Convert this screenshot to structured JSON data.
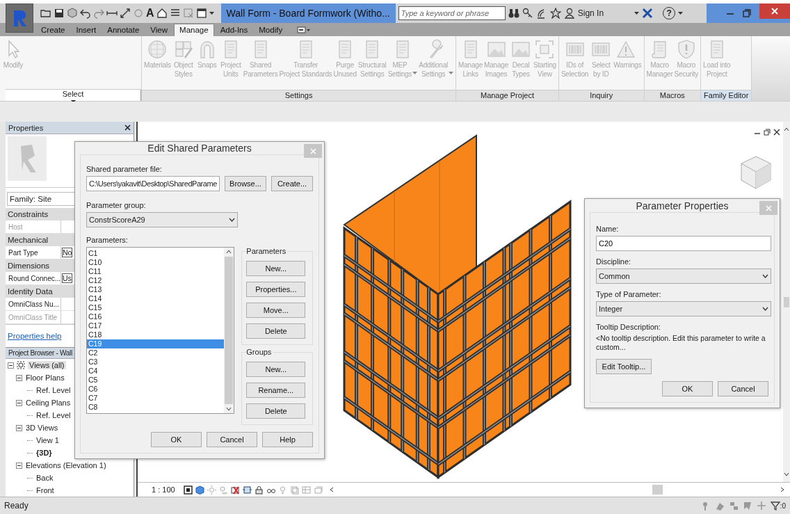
{
  "window": {
    "title": "Wall Form - Board Formwork (Witho...",
    "text_tool_glyph": "A",
    "search": {
      "placeholder": "Type a keyword or phrase"
    },
    "sign_in": "Sign In",
    "help_glyph": "?"
  },
  "tabs": [
    {
      "label": "Create",
      "selected": false
    },
    {
      "label": "Insert",
      "selected": false
    },
    {
      "label": "Annotate",
      "selected": false
    },
    {
      "label": "View",
      "selected": false
    },
    {
      "label": "Manage",
      "selected": true
    },
    {
      "label": "Add-Ins",
      "selected": false
    },
    {
      "label": "Modify",
      "selected": false
    }
  ],
  "ribbon": {
    "panels": [
      {
        "label": "Select",
        "menu": true,
        "highlighted": false,
        "buttons": [
          {
            "label": "Modify",
            "disabled": true,
            "menu": false
          }
        ]
      },
      {
        "label": "Settings",
        "menu": false,
        "highlighted": false,
        "buttons": [
          {
            "label": "Materials",
            "disabled": true,
            "menu": false
          },
          {
            "label": "Object\nStyles",
            "disabled": true,
            "menu": false
          },
          {
            "label": "Snaps",
            "disabled": true,
            "menu": false
          },
          {
            "label": "Project\nUnits",
            "disabled": true,
            "menu": false
          },
          {
            "label": "Shared\nParameters",
            "disabled": true,
            "menu": false
          },
          {
            "label": "Transfer\nProject Standards",
            "disabled": true,
            "menu": false
          },
          {
            "label": "Purge\nUnused",
            "disabled": true,
            "menu": false
          },
          {
            "label": "Structural\nSettings",
            "disabled": true,
            "menu": false
          },
          {
            "label": "MEP\nSettings",
            "disabled": true,
            "menu": true
          },
          {
            "label": "Additional\nSettings",
            "disabled": true,
            "menu": true
          }
        ]
      },
      {
        "label": "Manage Project",
        "menu": false,
        "highlighted": false,
        "buttons": [
          {
            "label": "Manage\nLinks",
            "disabled": true,
            "menu": false
          },
          {
            "label": "Manage\nImages",
            "disabled": true,
            "menu": false
          },
          {
            "label": "Decal\nTypes",
            "disabled": true,
            "menu": false
          },
          {
            "label": "Starting\nView",
            "disabled": true,
            "menu": false
          }
        ]
      },
      {
        "label": "Inquiry",
        "menu": false,
        "highlighted": false,
        "buttons": [
          {
            "label": "IDs of\nSelection",
            "disabled": true,
            "menu": false
          },
          {
            "label": "Select\nby ID",
            "disabled": true,
            "menu": false
          },
          {
            "label": "Warnings",
            "disabled": true,
            "menu": false
          }
        ]
      },
      {
        "label": "Macros",
        "menu": false,
        "highlighted": false,
        "buttons": [
          {
            "label": "Macro\nManager",
            "disabled": true,
            "menu": false
          },
          {
            "label": "Macro\nSecurity",
            "disabled": true,
            "menu": false
          }
        ]
      },
      {
        "label": "Family Editor",
        "menu": false,
        "highlighted": true,
        "buttons": [
          {
            "label": "Load into\nProject",
            "disabled": true,
            "menu": false
          }
        ]
      }
    ]
  },
  "properties": {
    "title": "Properties",
    "type_selector": "Family: Site",
    "groups": [
      {
        "label": "Constraints",
        "rows": [
          {
            "name": "Host",
            "disabled": true
          }
        ]
      },
      {
        "label": "Mechanical",
        "rows": [
          {
            "name": "Part Type",
            "value": "No",
            "disabled": false
          }
        ]
      },
      {
        "label": "Dimensions",
        "rows": [
          {
            "name": "Round Connec...",
            "value": "Us",
            "disabled": false
          }
        ]
      },
      {
        "label": "Identity Data",
        "rows": [
          {
            "name": "OmniClass Nu...",
            "disabled": false
          },
          {
            "name": "OmniClass Title",
            "disabled": true
          }
        ]
      }
    ],
    "help_link": "Properties help"
  },
  "project_browser": {
    "title": "Project Browser - Wall",
    "tree": [
      {
        "label": "Views (all)",
        "expanded": true,
        "selected": true,
        "children": [
          {
            "label": "Floor Plans",
            "expanded": true,
            "selected": false,
            "children": [
              {
                "label": "Ref. Level",
                "selected": false,
                "current": false
              }
            ]
          },
          {
            "label": "Ceiling Plans",
            "expanded": true,
            "selected": false,
            "children": [
              {
                "label": "Ref. Level",
                "selected": false,
                "current": false
              }
            ]
          },
          {
            "label": "3D Views",
            "expanded": true,
            "selected": false,
            "children": [
              {
                "label": "View 1",
                "selected": false,
                "current": false
              },
              {
                "label": "{3D}",
                "selected": false,
                "current": true
              }
            ]
          },
          {
            "label": "Elevations (Elevation 1)",
            "expanded": true,
            "selected": false,
            "children": [
              {
                "label": "Back",
                "selected": false,
                "current": false
              },
              {
                "label": "Front",
                "selected": false,
                "current": false
              }
            ]
          }
        ]
      }
    ]
  },
  "view_bar": {
    "scale": "1 : 100"
  },
  "edit_shared_parameters": {
    "title": "Edit Shared Parameters",
    "file_label": "Shared parameter file:",
    "file_path": "C:\\Users\\yakavit\\Desktop\\SharedParame",
    "browse": "Browse...",
    "create": "Create...",
    "group_label": "Parameter group:",
    "group": "ConstrScoreA29",
    "parameters_label": "Parameters:",
    "parameters": [
      {
        "name": "C1",
        "selected": false
      },
      {
        "name": "C10",
        "selected": false
      },
      {
        "name": "C11",
        "selected": false
      },
      {
        "name": "C12",
        "selected": false
      },
      {
        "name": "C13",
        "selected": false
      },
      {
        "name": "C14",
        "selected": false
      },
      {
        "name": "C15",
        "selected": false
      },
      {
        "name": "C16",
        "selected": false
      },
      {
        "name": "C17",
        "selected": false
      },
      {
        "name": "C18",
        "selected": false
      },
      {
        "name": "C19",
        "selected": true
      },
      {
        "name": "C2",
        "selected": false
      },
      {
        "name": "C3",
        "selected": false
      },
      {
        "name": "C4",
        "selected": false
      },
      {
        "name": "C5",
        "selected": false
      },
      {
        "name": "C6",
        "selected": false
      },
      {
        "name": "C7",
        "selected": false
      },
      {
        "name": "C8",
        "selected": false
      }
    ],
    "parameters_box": {
      "title": "Parameters",
      "buttons": [
        "New...",
        "Properties...",
        "Move...",
        "Delete"
      ]
    },
    "groups_box": {
      "title": "Groups",
      "buttons": [
        "New...",
        "Rename...",
        "Delete"
      ]
    },
    "buttons": [
      "OK",
      "Cancel",
      "Help"
    ]
  },
  "parameter_properties": {
    "title": "Parameter Properties",
    "name_label": "Name:",
    "name": "C20",
    "discipline_label": "Discipline:",
    "discipline": "Common",
    "type_label": "Type of Parameter:",
    "type": "Integer",
    "tooltip_label": "Tooltip Description:",
    "tooltip": "<No tooltip description. Edit this parameter to write a custom...",
    "edit_tooltip": "Edit Tooltip...",
    "buttons": [
      "OK",
      "Cancel"
    ]
  },
  "status_bar": {
    "text": "Ready",
    "filter_count": ":0"
  }
}
